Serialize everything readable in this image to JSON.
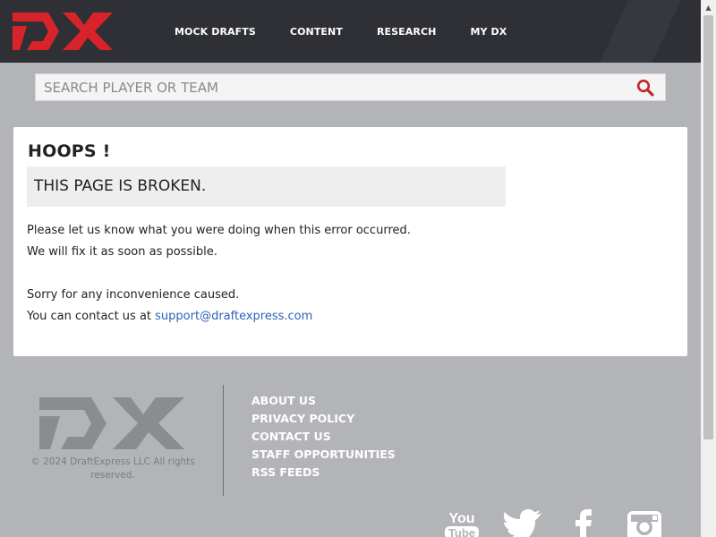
{
  "brand": {
    "logo_text": "DX",
    "accent_color": "#d8232a"
  },
  "nav": {
    "items": [
      "MOCK DRAFTS",
      "CONTENT",
      "RESEARCH",
      "MY DX"
    ]
  },
  "search": {
    "placeholder": "SEARCH PLAYER OR TEAM",
    "value": ""
  },
  "error": {
    "title": "HOOPS !",
    "subtitle": "THIS PAGE IS BROKEN.",
    "line1": "Please let us know what you were doing when this error occurred.",
    "line2": "We will fix it as soon as possible.",
    "line3": "Sorry for any inconvenience caused.",
    "line4_prefix": "You can contact us at ",
    "contact_email": "support@draftexpress.com"
  },
  "footer": {
    "copyright": "© 2024 DraftExpress LLC All rights reserved.",
    "links": [
      "ABOUT US",
      "PRIVACY POLICY",
      "CONTACT US",
      "STAFF OPPORTUNITIES",
      "RSS FEEDS"
    ],
    "social": [
      "youtube-icon",
      "twitter-icon",
      "facebook-icon",
      "instagram-icon"
    ]
  }
}
